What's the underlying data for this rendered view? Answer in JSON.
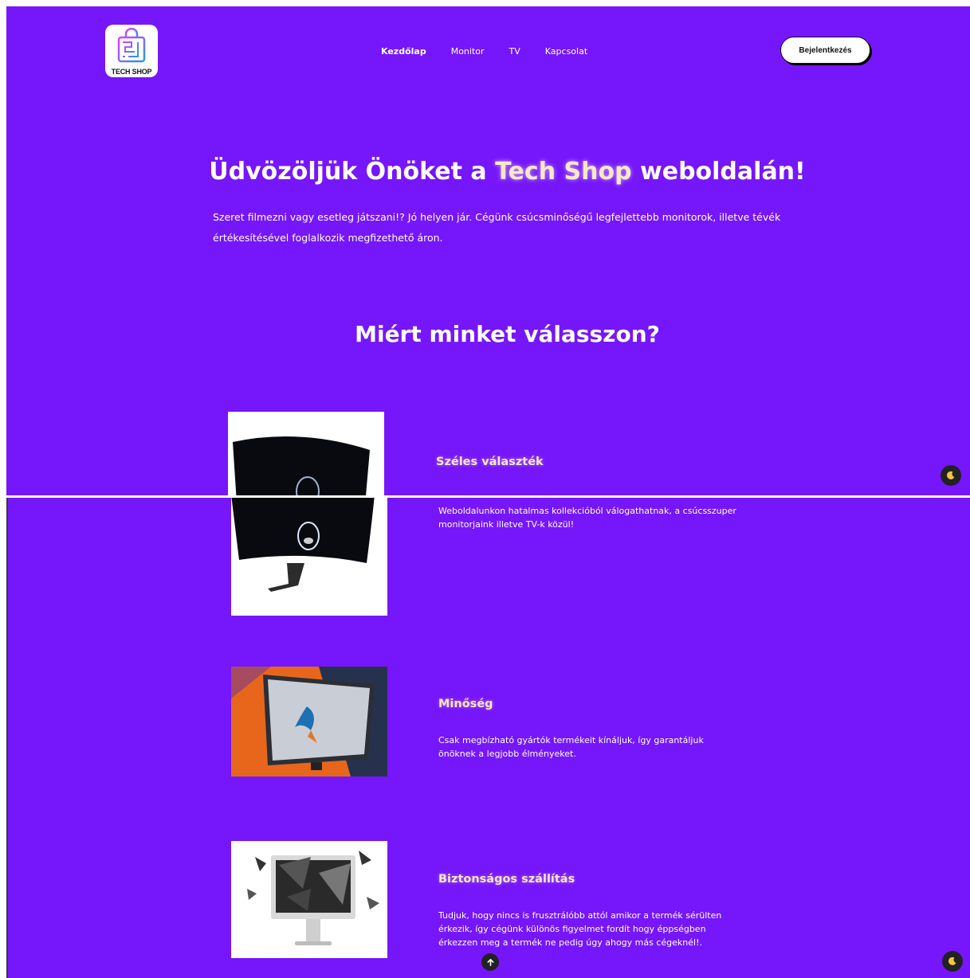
{
  "header": {
    "logo_text": "TECH SHOP",
    "nav": [
      "Kezdőlap",
      "Monitor",
      "TV",
      "Kapcsolat"
    ],
    "login_label": "Bejelentkezés"
  },
  "hero": {
    "title_before": "Üdvözöljük Önöket a ",
    "title_accent": "Tech Shop",
    "title_after": " weboldalán!",
    "text": "Szeret filmezni vagy esetleg játszani!? Jó helyen jár. Cégünk csúcsminőségű legfejlettebb monitorok, illetve tévék értékesítésével foglalkozik megfizethető áron."
  },
  "why": {
    "title": "Miért minket válasszon?"
  },
  "features": [
    {
      "title": "Széles választék",
      "text": "Weboldalunkon hatalmas kollekcióból válogathatnak, a csúcsszuper monitorjaink illetve TV-k közül!",
      "image_icon": "curved-monitor-icon"
    },
    {
      "title": "Minőség",
      "text": "Csak megbízható gyártók termékeit kínáljuk, így garantáljuk önöknek a legjobb élményeket.",
      "image_icon": "tv-kingfisher-icon"
    },
    {
      "title": "Biztonságos szállítás",
      "text": "Tudjuk, hogy nincs is frusztrálóbb attól amikor a termék sérülten érkezik, így cégünk különös figyelmet fordít hogy éppségben érkezzen meg a termék ne pedig úgy ahogy más cégeknél!.",
      "image_icon": "shattered-imac-icon"
    }
  ],
  "controls": {
    "dark_mode_icon": "moon-icon",
    "scroll_top_icon": "arrow-up-icon"
  },
  "colors": {
    "background": "#7616fb",
    "accent_text": "#f8e8c4"
  }
}
